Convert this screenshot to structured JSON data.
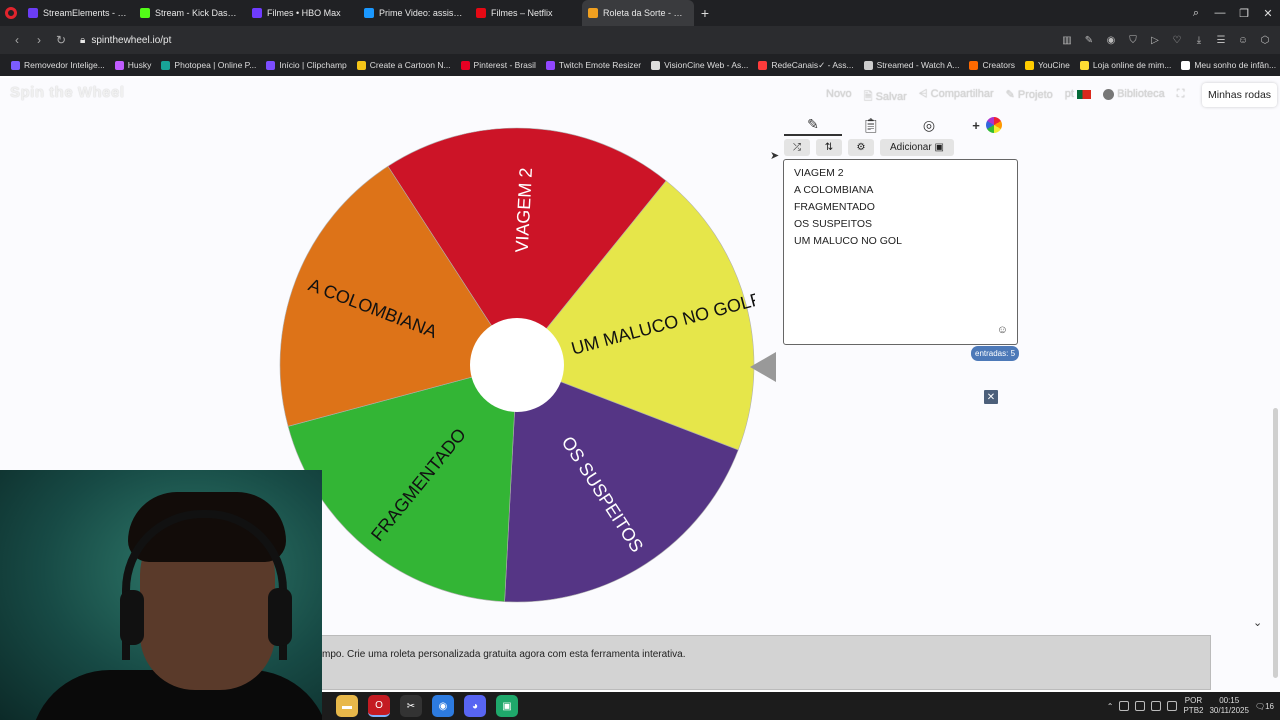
{
  "browser": {
    "tabs": [
      {
        "label": "StreamElements - Son",
        "color": "#6b3df5"
      },
      {
        "label": "Stream - Kick Dashboard",
        "color": "#53fc18"
      },
      {
        "label": "Filmes • HBO Max",
        "color": "#6f3cff"
      },
      {
        "label": "Prime Video: assista, alug",
        "color": "#1a98ff"
      },
      {
        "label": "Filmes – Netflix",
        "color": "#e50914"
      },
      {
        "label": "Roleta da Sorte - Escolha",
        "color": "#f0a020",
        "active": true
      }
    ],
    "new_tab": "+",
    "url": "spinthewheel.io/pt",
    "bookmarks": [
      {
        "label": "Removedor Intelige...",
        "color": "#7b5cff"
      },
      {
        "label": "Husky",
        "color": "#c05cff"
      },
      {
        "label": "Photopea | Online P...",
        "color": "#18a497"
      },
      {
        "label": "Início | Clipchamp",
        "color": "#7c4dff"
      },
      {
        "label": "Create a Cartoon N...",
        "color": "#f5c518"
      },
      {
        "label": "Pinterest - Brasil",
        "color": "#e60023"
      },
      {
        "label": "Twitch Emote Resizer",
        "color": "#9146ff"
      },
      {
        "label": "VisionCine Web - As...",
        "color": "#dddddd"
      },
      {
        "label": "RedeCanais✓ - Ass...",
        "color": "#ff3b3b"
      },
      {
        "label": "Streamed - Watch A...",
        "color": "#cccccc"
      },
      {
        "label": "Creators",
        "color": "#ff6a00"
      },
      {
        "label": "YouCine",
        "color": "#ffcc00"
      },
      {
        "label": "Loja online de mim...",
        "color": "#ffdd33"
      },
      {
        "label": "Meu sonho de infân...",
        "color": "#ffffff"
      }
    ]
  },
  "site": {
    "logo": "Spin the Wheel",
    "menu": {
      "new": "Novo",
      "save": "Salvar",
      "share": "Compartilhar",
      "project": "Projeto",
      "lang": "pt",
      "library": "Biblioteca"
    },
    "my_wheels": "Minhas rodas",
    "add_button": "Adicionar",
    "entries_label": "entradas: 5",
    "footer_text": "mpo. Crie uma roleta personalizada gratuita agora com esta ferramenta interativa."
  },
  "wheel": {
    "segments": [
      {
        "label": "VIAGEM 2",
        "color": "#cc1427"
      },
      {
        "label": "UM MALUCO NO GOLF",
        "color": "#e6e64a"
      },
      {
        "label": "OS SUSPEITOS",
        "color": "#553585"
      },
      {
        "label": "FRAGMENTADO",
        "color": "#33b535"
      },
      {
        "label": "A COLOMBIANA",
        "color": "#dd7318"
      }
    ]
  },
  "entries": [
    "VIAGEM 2",
    "A COLOMBIANA",
    "FRAGMENTADO",
    "OS SUSPEITOS",
    "UM MALUCO NO GOL"
  ],
  "taskbar": {
    "lang_top": "POR",
    "lang_bottom": "PTB2",
    "time": "00:15",
    "date": "30/11/2025",
    "notif": "16"
  }
}
